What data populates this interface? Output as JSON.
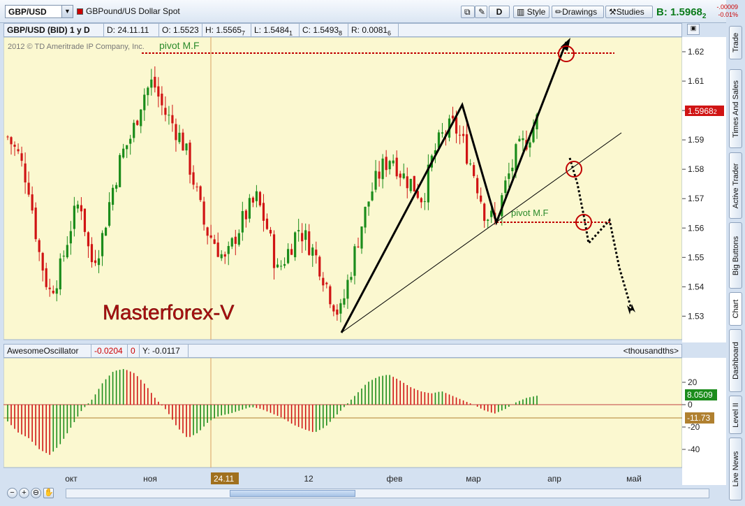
{
  "toolbar": {
    "symbol": "GBP/USD",
    "description": "GBPound/US Dollar Spot",
    "period_button": "D",
    "style_label": "Style",
    "drawings_label": "Drawings",
    "studies_label": "Studies",
    "bid_label": "B: 1.5968",
    "bid_fraction": "2",
    "change_abs": "-.00009",
    "change_pct": "-0.01%"
  },
  "side_tabs": [
    "Trade",
    "Times And Sales",
    "Active Trader",
    "Big Buttons",
    "Chart",
    "Dashboard",
    "Level II",
    "Live News"
  ],
  "header": {
    "instrument": "GBP/USD (BID) 1 y D",
    "date": "D: 24.11.11",
    "open": "O: 1.5523",
    "high": "H: 1.5565",
    "high_frac": "7",
    "low": "L: 1.5484",
    "low_frac": "1",
    "close": "C: 1.5493",
    "close_frac": "8",
    "range": "R: 0.0081",
    "range_frac": "6"
  },
  "copyright": "2012 © TD Ameritrade IP Company, Inc.",
  "annotations": {
    "pivot_top": "pivot M.F",
    "pivot_mid": "pivot M.F",
    "watermark": "Masterforex-V"
  },
  "price_axis": {
    "ticks": [
      "1.62",
      "1.61",
      "1.6",
      "1.59",
      "1.58",
      "1.57",
      "1.56",
      "1.55",
      "1.54",
      "1.53"
    ],
    "last_price": "1.5968",
    "last_price_frac": "2"
  },
  "oscillator": {
    "name": "AwesomeOscillator",
    "value": "-0.0204",
    "zero": "0",
    "y_readout": "Y: -0.0117",
    "units": "<thousandths>",
    "ticks": [
      "20",
      "0",
      "-20",
      "-40"
    ],
    "current_label": "8.0509",
    "cursor_label": "-11.73"
  },
  "time_axis": {
    "labels": [
      "окт",
      "ноя",
      "12",
      "фев",
      "мар",
      "апр",
      "май"
    ],
    "cursor_label": "24.11"
  },
  "colors": {
    "up": "#1b8c1b",
    "down": "#d01414",
    "panel_bg": "#fbf8d0",
    "pivot": "#c00000"
  },
  "chart_data": [
    {
      "type": "candlestick",
      "title": "GBP/USD (BID) 1 y D",
      "ylim": [
        1.522,
        1.625
      ],
      "x_labels": [
        "окт",
        "ноя",
        "12",
        "фев",
        "мар",
        "апр",
        "май"
      ],
      "close_path": [
        1.591,
        1.585,
        1.575,
        1.552,
        1.538,
        1.545,
        1.56,
        1.57,
        1.548,
        1.555,
        1.572,
        1.585,
        1.592,
        1.605,
        1.61,
        1.6,
        1.595,
        1.588,
        1.575,
        1.56,
        1.555,
        1.548,
        1.558,
        1.565,
        1.57,
        1.56,
        1.545,
        1.552,
        1.56,
        1.555,
        1.548,
        1.538,
        1.53,
        1.545,
        1.56,
        1.572,
        1.58,
        1.585,
        1.578,
        1.575,
        1.57,
        1.585,
        1.592,
        1.595,
        1.588,
        1.578,
        1.565,
        1.562,
        1.575,
        1.585,
        1.59,
        1.5968
      ],
      "last": 1.59682,
      "pivots": [
        1.6165,
        1.5603
      ]
    },
    {
      "type": "bar",
      "title": "AwesomeOscillator",
      "ylabel": "<thousandths>",
      "ylim": [
        -50,
        30
      ],
      "values_path": [
        -15,
        -25,
        -30,
        -40,
        -45,
        -35,
        -20,
        -5,
        5,
        20,
        30,
        32,
        28,
        18,
        5,
        -5,
        -20,
        -30,
        -25,
        -15,
        -10,
        -8,
        -5,
        -2,
        -4,
        -8,
        -12,
        -18,
        -22,
        -25,
        -20,
        -10,
        0,
        10,
        20,
        25,
        27,
        22,
        16,
        12,
        10,
        12,
        8,
        4,
        0,
        -5,
        -8,
        -4,
        2,
        6,
        8
      ],
      "current": 8.0509
    }
  ]
}
